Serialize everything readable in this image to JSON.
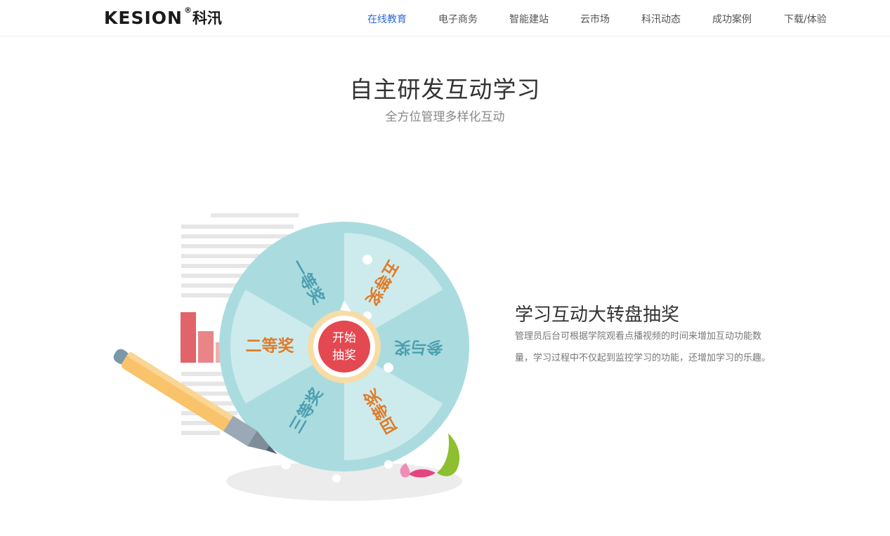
{
  "header": {
    "logo_latin": "KESION",
    "logo_reg": "®",
    "logo_cn": "科汛",
    "nav": [
      {
        "label": "在线教育",
        "active": true
      },
      {
        "label": "电子商务",
        "active": false
      },
      {
        "label": "智能建站",
        "active": false
      },
      {
        "label": "云市场",
        "active": false
      },
      {
        "label": "科汛动态",
        "active": false
      },
      {
        "label": "成功案例",
        "active": false
      },
      {
        "label": "下载/体验",
        "active": false
      }
    ]
  },
  "hero": {
    "title": "自主研发互动学习",
    "subtitle": "全方位管理多样化互动"
  },
  "wheel": {
    "center_line1": "开始",
    "center_line2": "抽奖",
    "segments": [
      "一等奖",
      "五等奖",
      "参与奖",
      "四等奖",
      "三等奖",
      "二等奖"
    ]
  },
  "feature": {
    "title": "学习互动大转盘抽奖",
    "description": "管理员后台可根据学院观看点播视频的时间来增加互动功能数量，学习过程中不仅起到监控学习的功能，还增加学习的乐趣。"
  },
  "colors": {
    "nav_active": "#2d6ad6",
    "wheel_base": "#aadcdf",
    "wheel_light": "#cdebed",
    "prize_orange": "#e07b28",
    "prize_teal": "#4d9fb0",
    "center_red": "#e44850"
  }
}
